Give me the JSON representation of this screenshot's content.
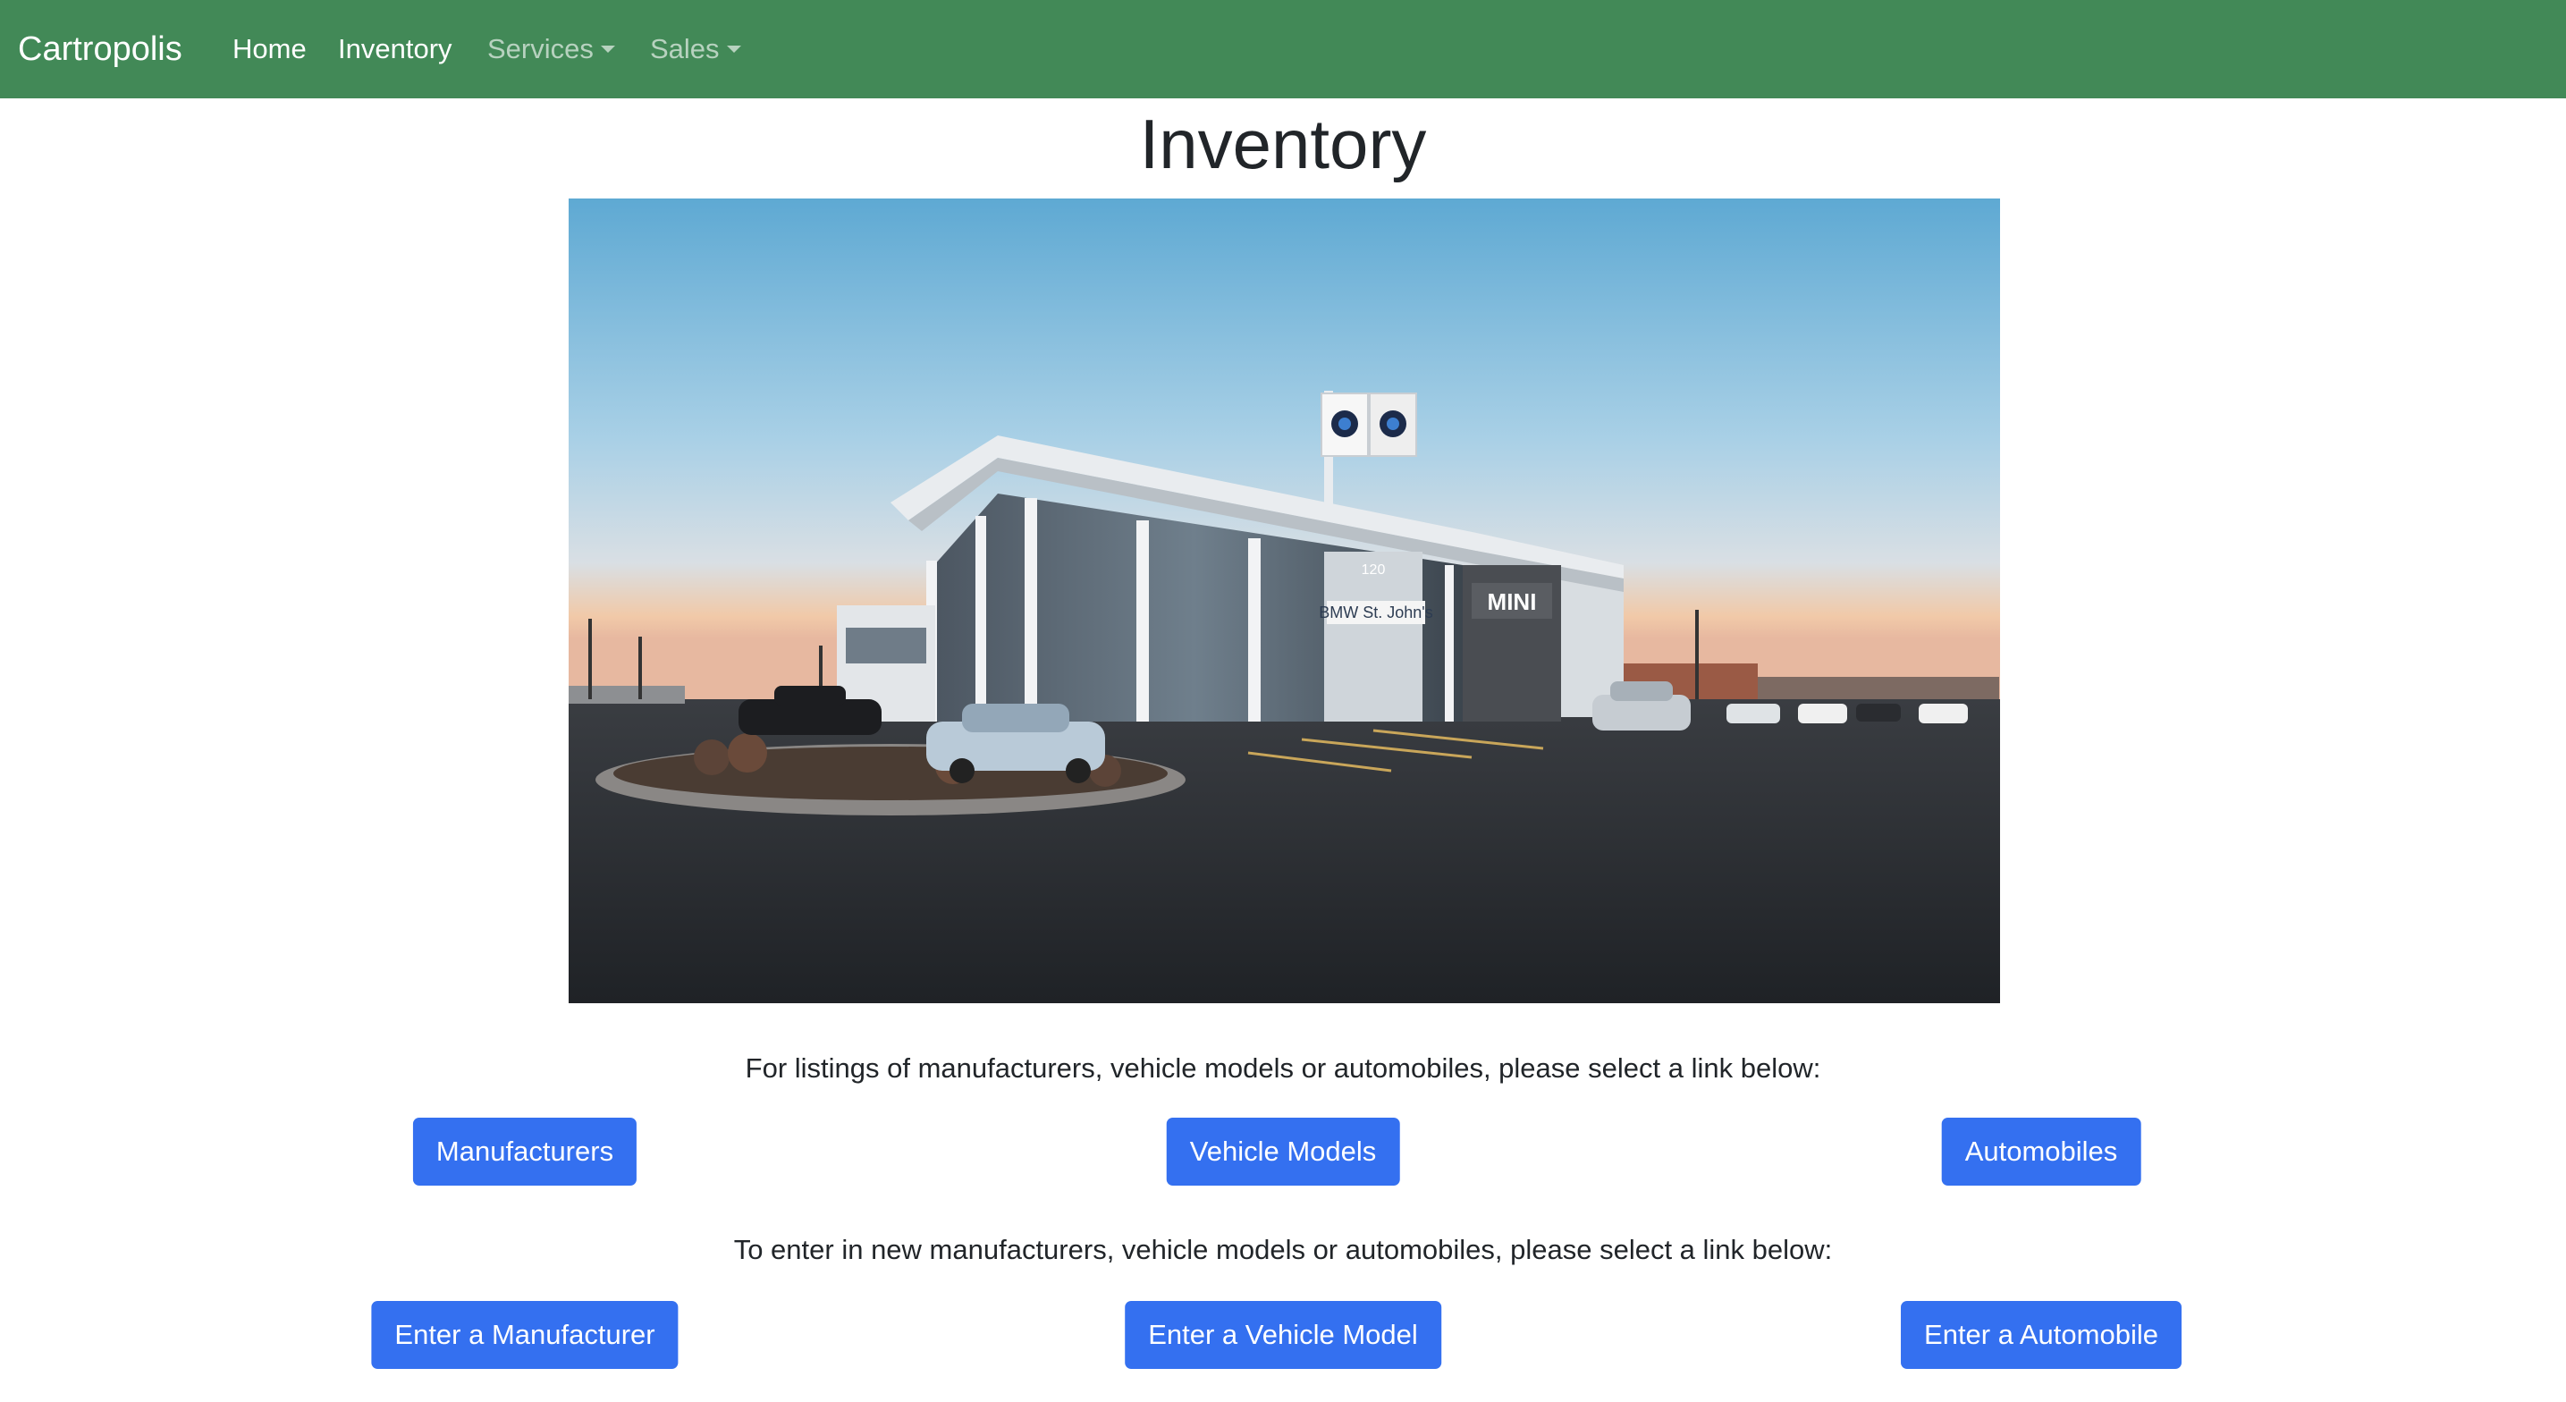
{
  "navbar": {
    "brand": "Cartropolis",
    "links": [
      {
        "label": "Home",
        "active": true
      },
      {
        "label": "Inventory",
        "active": true
      },
      {
        "label": "Services",
        "dropdown": true
      },
      {
        "label": "Sales",
        "dropdown": true
      }
    ],
    "background_color": "#428957"
  },
  "main": {
    "title": "Inventory",
    "hero_image": {
      "signage": [
        "120",
        "BMW St. John's",
        "MINI"
      ]
    },
    "listings_prompt": "For listings of manufacturers, vehicle models or automobiles, please select a link below:",
    "listing_buttons": [
      "Manufacturers",
      "Vehicle Models",
      "Automobiles"
    ],
    "entry_prompt": "To enter in new manufacturers, vehicle models or automobiles, please select a link below:",
    "entry_buttons": [
      "Enter a Manufacturer",
      "Enter a Vehicle Model",
      "Enter a Automobile"
    ],
    "button_color": "#3470f0"
  }
}
